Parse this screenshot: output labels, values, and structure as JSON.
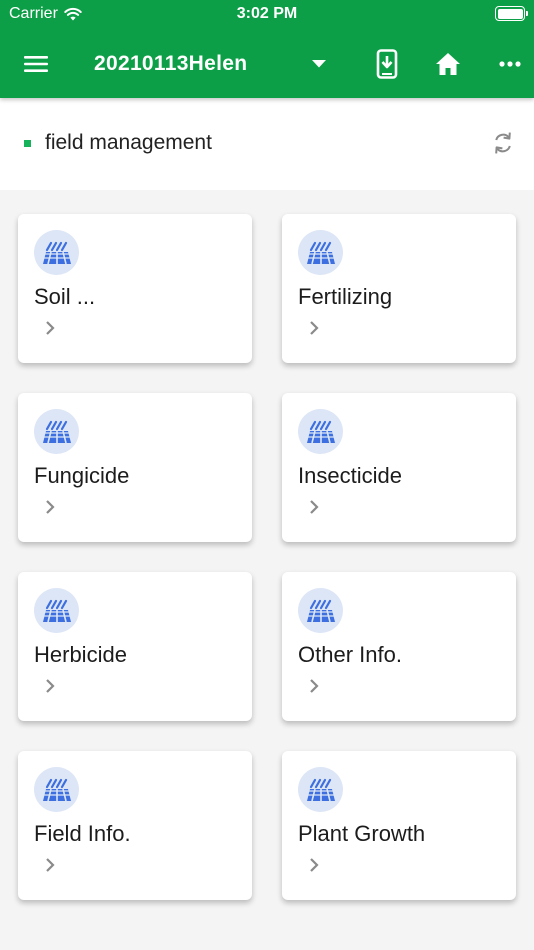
{
  "status_bar": {
    "carrier": "Carrier",
    "time": "3:02 PM"
  },
  "toolbar": {
    "title": "20210113Helen",
    "icons": {
      "menu": "menu-icon",
      "dropdown": "dropdown-arrow-icon",
      "download": "download-to-phone-icon",
      "home": "home-icon",
      "more": "more-horizontal-icon"
    }
  },
  "section": {
    "heading": "field management",
    "refresh_icon": "refresh-icon"
  },
  "colors": {
    "app_bar": "#0d9f47",
    "accent_bullet": "#17b35a",
    "icon_blue": "#3d6fe0",
    "icon_bg": "#dde6f6",
    "background": "#f4f4f4"
  },
  "cards": [
    {
      "label": "Soil ...",
      "icon": "field-rows-icon"
    },
    {
      "label": "Fertilizing",
      "icon": "field-rows-icon"
    },
    {
      "label": "Fungicide",
      "icon": "field-rows-icon"
    },
    {
      "label": "Insecticide",
      "icon": "field-rows-icon"
    },
    {
      "label": "Herbicide",
      "icon": "field-rows-icon"
    },
    {
      "label": "Other Info.",
      "icon": "field-rows-icon"
    },
    {
      "label": "Field Info.",
      "icon": "field-rows-icon"
    },
    {
      "label": "Plant Growth",
      "icon": "field-rows-icon"
    }
  ]
}
